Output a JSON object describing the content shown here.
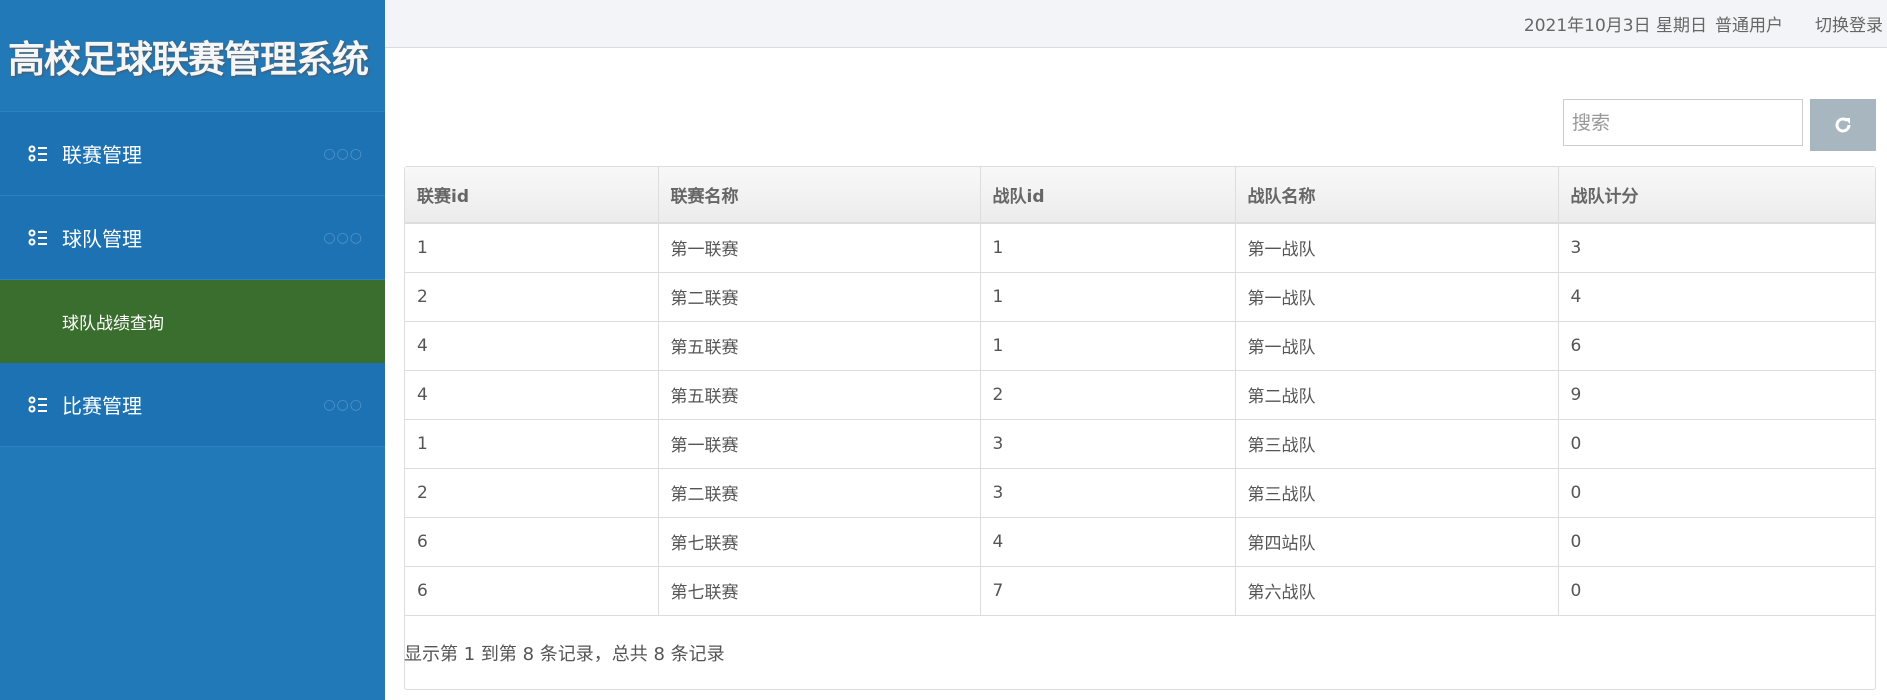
{
  "sidebar": {
    "logo": "高校足球联赛管理系统",
    "menus": [
      {
        "label": "联赛管理"
      },
      {
        "label": "球队管理"
      },
      {
        "label": "比赛管理"
      }
    ],
    "submenu": "球队战绩查询",
    "dots": "○○○"
  },
  "header": {
    "date": "2021年10月3日 星期日",
    "role": "普通用户",
    "switch_login": "切换登录"
  },
  "toolbar": {
    "search_placeholder": "搜索"
  },
  "table": {
    "headers": [
      "联赛id",
      "联赛名称",
      "战队id",
      "战队名称",
      "战队计分"
    ],
    "rows": [
      [
        "1",
        "第一联赛",
        "1",
        "第一战队",
        "3"
      ],
      [
        "2",
        "第二联赛",
        "1",
        "第一战队",
        "4"
      ],
      [
        "4",
        "第五联赛",
        "1",
        "第一战队",
        "6"
      ],
      [
        "4",
        "第五联赛",
        "2",
        "第二战队",
        "9"
      ],
      [
        "1",
        "第一联赛",
        "3",
        "第三战队",
        "0"
      ],
      [
        "2",
        "第二联赛",
        "3",
        "第三战队",
        "0"
      ],
      [
        "6",
        "第七联赛",
        "4",
        "第四站队",
        "0"
      ],
      [
        "6",
        "第七联赛",
        "7",
        "第六战队",
        "0"
      ]
    ]
  },
  "footer": {
    "summary": "显示第 1 到第 8 条记录，总共 8 条记录"
  }
}
